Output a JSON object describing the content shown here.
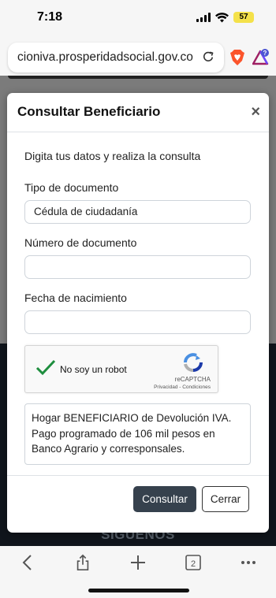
{
  "status_bar": {
    "time": "7:18",
    "battery": "57"
  },
  "browser": {
    "url": "cioniva.prosperidadsocial.gov.co",
    "rewards_badge": "?",
    "tab_count": "2"
  },
  "page": {
    "footer_heading": "SIGUENOS"
  },
  "modal": {
    "title": "Consultar Beneficiario",
    "close_label": "×",
    "intro": "Digita tus datos y realiza la consulta",
    "fields": [
      {
        "label": "Tipo de documento",
        "value": "Cédula de ciudadanía"
      },
      {
        "label": "Número de documento",
        "value": ""
      },
      {
        "label": "Fecha de nacimiento",
        "value": ""
      }
    ],
    "captcha": {
      "label": "No soy un robot",
      "brand": "reCAPTCHA",
      "links": "Privacidad - Condiciones",
      "checked": true
    },
    "result": "Hogar BENEFICIARIO de Devolución IVA. Pago programado de 106 mil pesos en Banco Agrario y corresponsales.",
    "buttons": {
      "submit": "Consultar",
      "close": "Cerrar"
    }
  },
  "colors": {
    "primary_button": "#36414d",
    "check_green": "#1e8e3e",
    "battery": "#f4e14a"
  }
}
